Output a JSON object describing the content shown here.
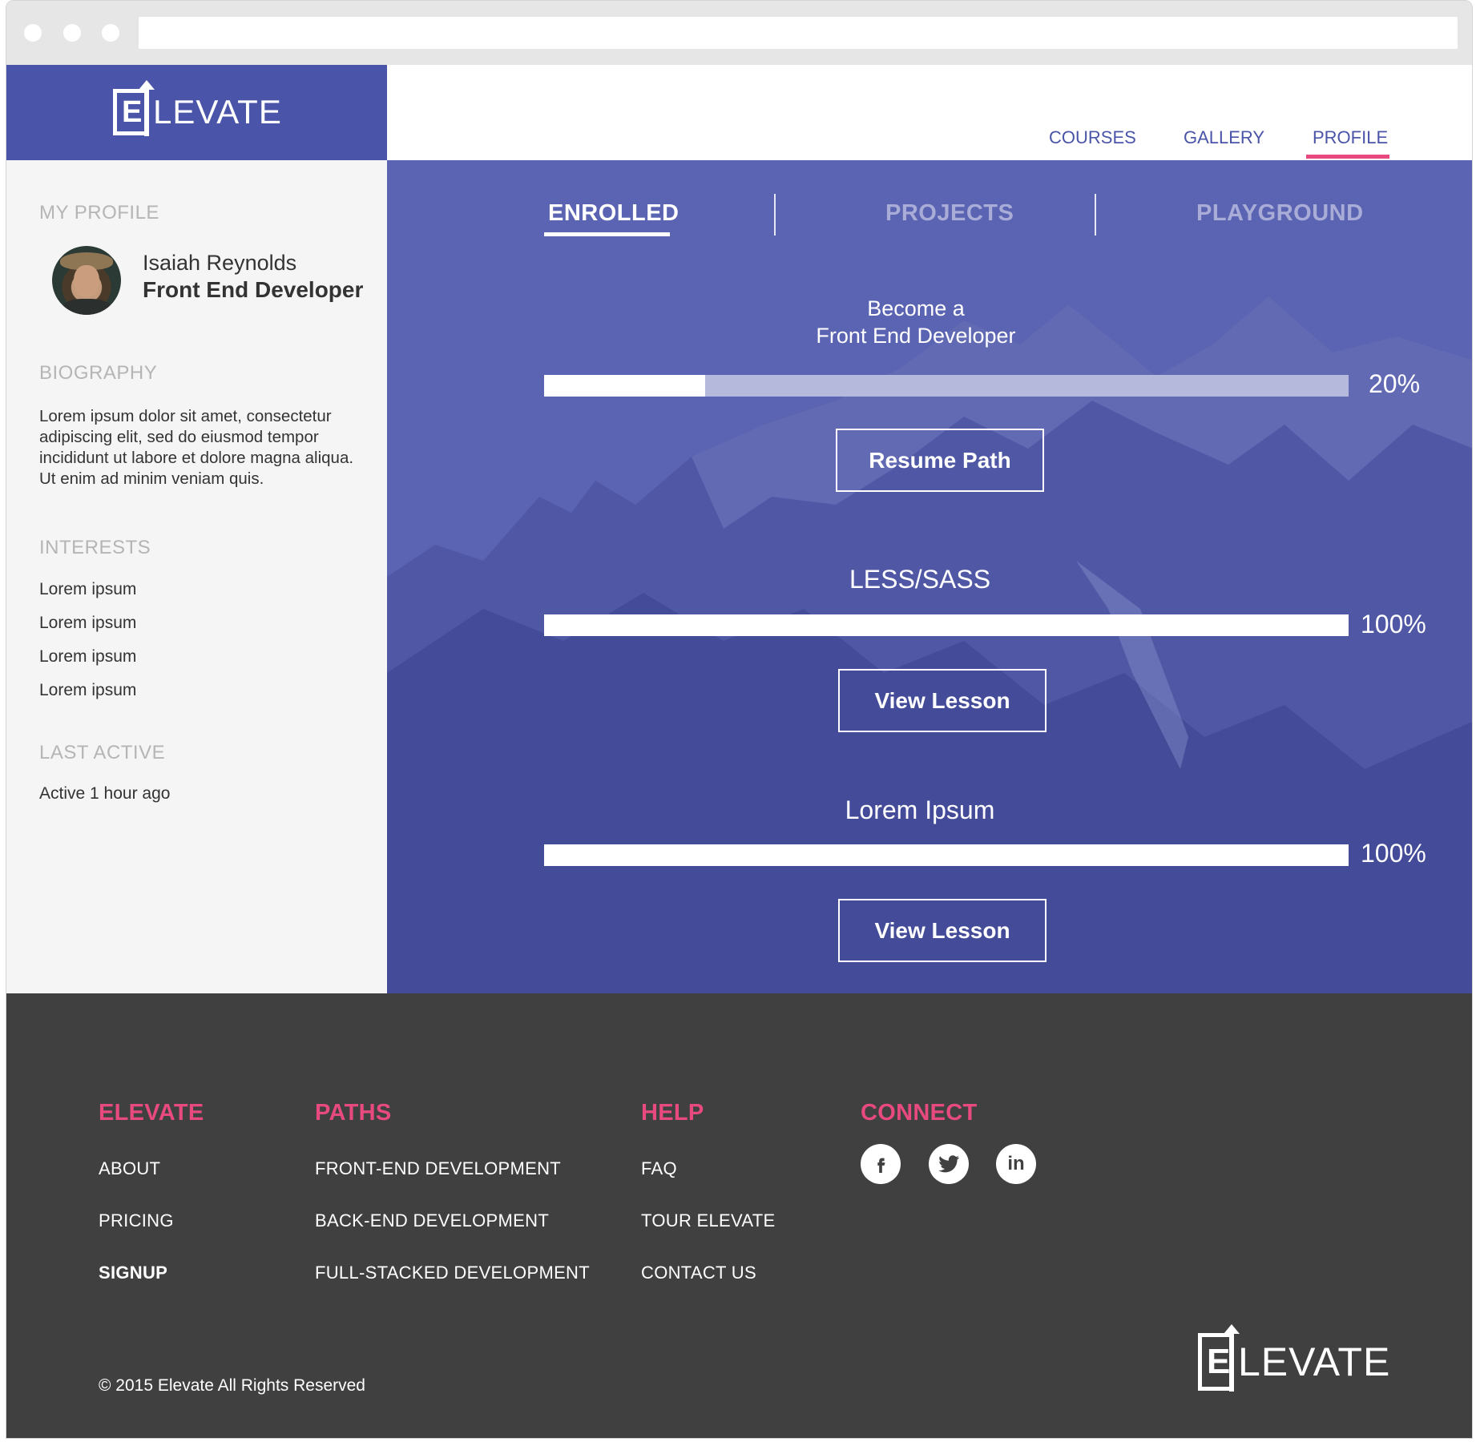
{
  "brand": {
    "name": "ELEVATE",
    "logo_letter": "E",
    "logo_word": "LEVATE",
    "accent_color": "#e84a7f",
    "primary_color": "#4a54a8"
  },
  "topnav": {
    "items": [
      {
        "label": "COURSES"
      },
      {
        "label": "GALLERY"
      },
      {
        "label": "PROFILE",
        "active": true
      }
    ]
  },
  "sidebar": {
    "profile_heading": "MY PROFILE",
    "user_name": "Isaiah Reynolds",
    "user_role": "Front End Developer",
    "bio_heading": "BIOGRAPHY",
    "bio_text": "Lorem ipsum dolor sit amet, consectetur adipiscing elit, sed do eiusmod tempor incididunt ut labore et dolore magna aliqua. Ut enim ad minim veniam quis.",
    "interests_heading": "INTERESTS",
    "interests": [
      "Lorem ipsum",
      "Lorem ipsum",
      "Lorem ipsum",
      "Lorem ipsum"
    ],
    "last_active_heading": "LAST ACTIVE",
    "last_active": "Active 1 hour ago"
  },
  "tabs": [
    {
      "label": "ENROLLED",
      "active": true
    },
    {
      "label": "PROJECTS"
    },
    {
      "label": "PLAYGROUND"
    }
  ],
  "courses": [
    {
      "title_line1": "Become a",
      "title_line2": "Front End Developer",
      "progress": 20,
      "progress_label": "20%",
      "button": "Resume Path"
    },
    {
      "title": "LESS/SASS",
      "progress": 100,
      "progress_label": "100%",
      "button": "View Lesson"
    },
    {
      "title": "Lorem Ipsum",
      "progress": 100,
      "progress_label": "100%",
      "button": "View Lesson"
    }
  ],
  "footer": {
    "columns": [
      {
        "heading": "ELEVATE",
        "links": [
          {
            "label": "ABOUT"
          },
          {
            "label": "PRICING"
          },
          {
            "label": "SIGNUP",
            "bold": true
          }
        ]
      },
      {
        "heading": "PATHS",
        "links": [
          {
            "label": "FRONT-END DEVELOPMENT"
          },
          {
            "label": "BACK-END DEVELOPMENT"
          },
          {
            "label": "FULL-STACKED DEVELOPMENT"
          }
        ]
      },
      {
        "heading": "HELP",
        "links": [
          {
            "label": "FAQ"
          },
          {
            "label": "TOUR ELEVATE"
          },
          {
            "label": "CONTACT US"
          }
        ]
      },
      {
        "heading": "CONNECT"
      }
    ],
    "social_icons": [
      "facebook-icon",
      "twitter-icon",
      "linkedin-icon"
    ],
    "copyright": "© 2015 Elevate All Rights Reserved"
  }
}
